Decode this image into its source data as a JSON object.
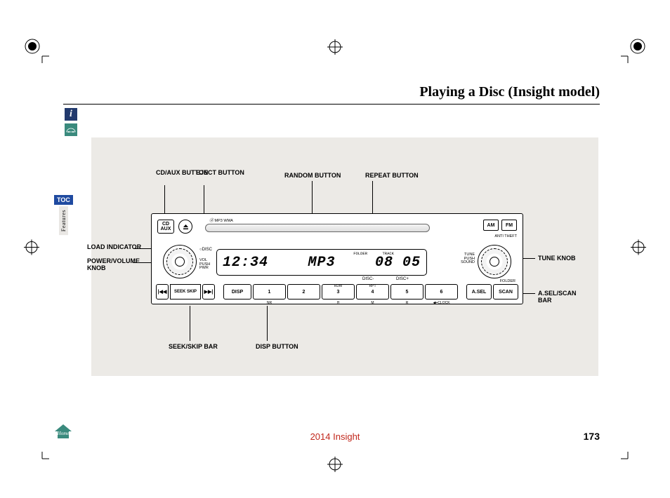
{
  "page": {
    "title": "Playing a Disc (Insight model)",
    "model_footer": "2014 Insight",
    "page_number": "173"
  },
  "nav": {
    "toc": "TOC",
    "features": "Features",
    "home": "Home"
  },
  "callouts": {
    "cd_aux": "CD/AUX BUTTON",
    "eject": "EJECT BUTTON",
    "random": "RANDOM BUTTON",
    "repeat": "REPEAT BUTTON",
    "load": "LOAD INDICATOR",
    "power_vol": "POWER/VOLUME KNOB",
    "tune": "TUNE KNOB",
    "asel": "A.SEL/SCAN BAR",
    "seek": "SEEK/SKIP BAR",
    "disp": "DISP BUTTON"
  },
  "radio": {
    "cd_aux_btn": "CD AUX",
    "am": "AM",
    "fm": "FM",
    "anti_theft": "ANTI THEFT",
    "disc_label": "DISC",
    "vol": "VOL",
    "push": "PUSH",
    "pwr": "PWR",
    "tune": "TUNE",
    "tune_push": "PUSH",
    "sound": "SOUND",
    "folder": "FOLDER",
    "mp3": "MP3",
    "wma": "WMA",
    "lcd": {
      "time": "12:34",
      "mode": "MP3",
      "counter": "08 05",
      "folder": "FOLDER",
      "track": "TRACK",
      "disc_minus": "DISC-",
      "disc_plus": "DISC+"
    },
    "bar": {
      "seek_skip": "SEEK SKIP",
      "disp": "DISP",
      "b1": "1",
      "b2": "2",
      "b3": "3",
      "b3_top": "RDM",
      "b4": "4",
      "b4_top": "RPT",
      "b5": "5",
      "b6": "6",
      "asel": "A.SEL",
      "scan": "SCAN",
      "nr": "NR",
      "h": "H",
      "m": "M",
      "r": "R",
      "clock": "CLOCK"
    }
  }
}
